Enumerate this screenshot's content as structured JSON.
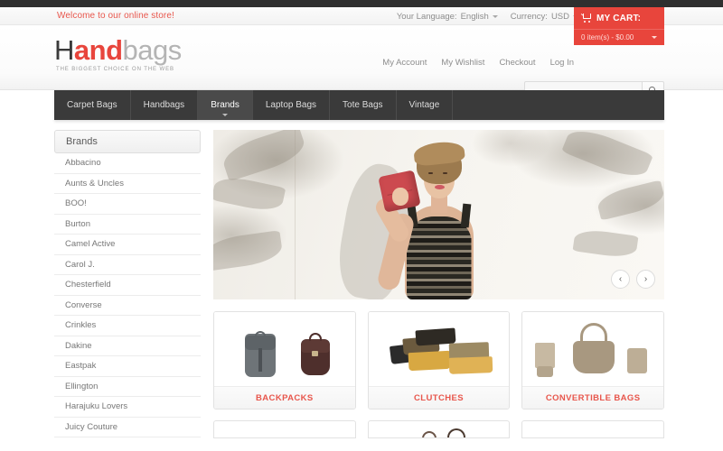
{
  "topbar": {
    "welcome": "Welcome to our online store!",
    "language_label": "Your Language:",
    "language_value": "English",
    "currency_label": "Currency:",
    "currency_value": "USD"
  },
  "cart": {
    "title": "MY CART:",
    "summary": "0 item(s) - $0.00",
    "icon": "shopping-cart-icon",
    "bg_color": "#e8453c"
  },
  "logo": {
    "part1": "H",
    "part2": "and",
    "part3": "bags",
    "tagline": "THE BIGGEST CHOICE ON THE WEB",
    "accent_color": "#e8453c"
  },
  "account_links": [
    {
      "label": "My Account"
    },
    {
      "label": "My Wishlist"
    },
    {
      "label": "Checkout"
    },
    {
      "label": "Log In"
    }
  ],
  "search": {
    "value": "",
    "placeholder": "",
    "icon": "search-icon"
  },
  "nav": {
    "items": [
      {
        "label": "Carpet Bags",
        "active": false,
        "has_dropdown": false
      },
      {
        "label": "Handbags",
        "active": false,
        "has_dropdown": false
      },
      {
        "label": "Brands",
        "active": true,
        "has_dropdown": true
      },
      {
        "label": "Laptop Bags",
        "active": false,
        "has_dropdown": false
      },
      {
        "label": "Tote Bags",
        "active": false,
        "has_dropdown": false
      },
      {
        "label": "Vintage",
        "active": false,
        "has_dropdown": false
      }
    ]
  },
  "sidebar": {
    "title": "Brands",
    "items": [
      {
        "label": "Abbacino"
      },
      {
        "label": "Aunts & Uncles"
      },
      {
        "label": "BOO!"
      },
      {
        "label": "Burton"
      },
      {
        "label": "Camel Active"
      },
      {
        "label": "Carol J."
      },
      {
        "label": "Chesterfield"
      },
      {
        "label": "Converse"
      },
      {
        "label": "Crinkles"
      },
      {
        "label": "Dakine"
      },
      {
        "label": "Eastpak"
      },
      {
        "label": "Ellington"
      },
      {
        "label": "Harajuku Lovers"
      },
      {
        "label": "Juicy Couture"
      }
    ]
  },
  "hero": {
    "alt": "Woman holding a red clutch bag against a light wall with palm shadows",
    "prev_label": "‹",
    "next_label": "›"
  },
  "categories": [
    {
      "label": "BACKPACKS",
      "art": "backpacks"
    },
    {
      "label": "CLUTCHES",
      "art": "clutches"
    },
    {
      "label": "CONVERTIBLE BAGS",
      "art": "convertible"
    }
  ],
  "category_label_color": "#e8564c"
}
